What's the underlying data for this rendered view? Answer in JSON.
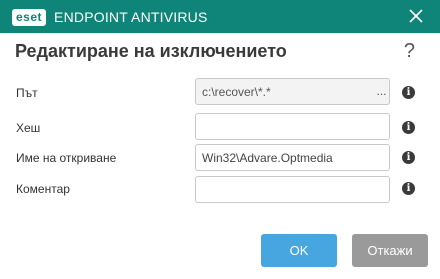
{
  "app": {
    "logo_text": "eset",
    "product_name": "ENDPOINT ANTIVIRUS",
    "close_glyph": "×"
  },
  "dialog": {
    "title": "Редактиране на изключението",
    "help_glyph": "?"
  },
  "form": {
    "path": {
      "label": "Път",
      "value": "c:\\recover\\*.*",
      "browse_label": "..."
    },
    "hash": {
      "label": "Хеш",
      "value": ""
    },
    "detection": {
      "label": "Име на откриване",
      "value": "Win32\\Advare.Optmedia"
    },
    "comment": {
      "label": "Коментар",
      "value": ""
    },
    "info_glyph": "i"
  },
  "buttons": {
    "ok_label": "OK",
    "cancel_label": "Откажи"
  },
  "colors": {
    "titlebar": "#0f8579",
    "ok_button": "#47a6e0",
    "cancel_button": "#9a9a9a"
  }
}
